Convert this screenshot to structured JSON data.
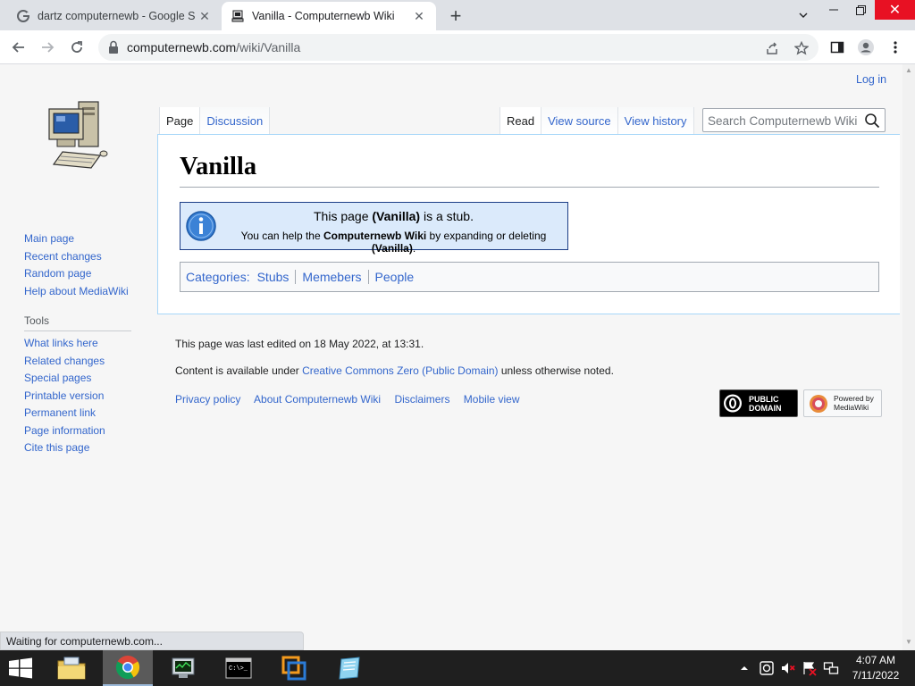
{
  "browser": {
    "tabs": [
      {
        "title": "dartz computernewb - Google S",
        "active": false
      },
      {
        "title": "Vanilla - Computernewb Wiki",
        "active": true
      }
    ],
    "url_domain": "computernewb.com",
    "url_path": "/wiki/Vanilla",
    "status_text": "Waiting for computernewb.com..."
  },
  "page": {
    "login_label": "Log in",
    "tabs_left": [
      "Page",
      "Discussion"
    ],
    "tabs_right": [
      "Read",
      "View source",
      "View history"
    ],
    "search_placeholder": "Search Computernewb Wiki",
    "title": "Vanilla",
    "stub": {
      "l1_pre": "This page ",
      "l1_bold": "(Vanilla)",
      "l1_post": " is a stub.",
      "l2_pre": "You can help the ",
      "l2_bold1": "Computernewb Wiki",
      "l2_mid": " by expanding or deleting ",
      "l2_bold2": "(Vanilla)",
      "l2_post": "."
    },
    "categories_label": "Categories:",
    "categories": [
      "Stubs",
      "Memebers",
      "People"
    ]
  },
  "sidebar": {
    "nav": [
      "Main page",
      "Recent changes",
      "Random page",
      "Help about MediaWiki"
    ],
    "tools_heading": "Tools",
    "tools": [
      "What links here",
      "Related changes",
      "Special pages",
      "Printable version",
      "Permanent link",
      "Page information",
      "Cite this page"
    ]
  },
  "footer": {
    "last_edited": "This page was last edited on 18 May 2022, at 13:31.",
    "license_pre": "Content is available under ",
    "license_link": "Creative Commons Zero (Public Domain)",
    "license_post": " unless otherwise noted.",
    "links": [
      "Privacy policy",
      "About Computernewb Wiki",
      "Disclaimers",
      "Mobile view"
    ],
    "badge_pd_line1": "PUBLIC",
    "badge_pd_line2": "DOMAIN",
    "badge_mw_line1": "Powered by",
    "badge_mw_line2": "MediaWiki"
  },
  "taskbar": {
    "time": "4:07 AM",
    "date": "7/11/2022"
  },
  "colors": {
    "link": "#3366cc",
    "stub_bg": "#dbeafb",
    "taskbar": "#1f1f1f"
  }
}
